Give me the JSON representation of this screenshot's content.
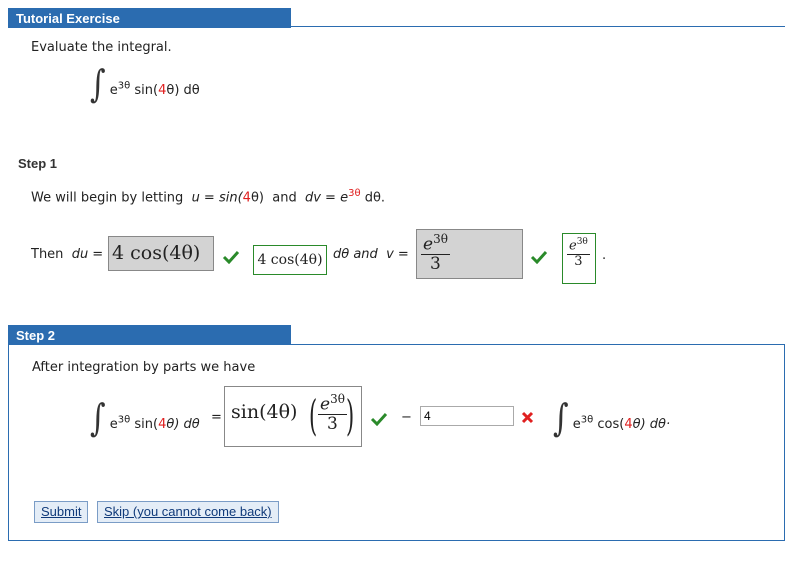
{
  "header": {
    "title": "Tutorial Exercise"
  },
  "intro": {
    "prompt": "Evaluate the integral.",
    "integral": {
      "exp": "3θ",
      "func": "sin(",
      "coef": "4",
      "arg_tail": "θ) dθ"
    }
  },
  "step1": {
    "title": "Step 1",
    "sentence": {
      "pre": "We will begin by letting",
      "u_eq": "u = sin(",
      "u_coef": "4",
      "u_tail": "θ)",
      "and": "and",
      "dv_eq": "dv = e",
      "dv_exp": "3θ",
      "dv_tail": " dθ."
    },
    "then_label": "Then",
    "du_label": "du =",
    "du_answer": "4 cos(4θ)",
    "du_correct": "4 cos(4θ)",
    "dtheta_and": "dθ and",
    "v_label": "v =",
    "v_answer": {
      "num": "e",
      "num_exp": "3θ",
      "den": "3"
    },
    "v_correct": {
      "num": "e",
      "num_exp": "3θ",
      "den": "3"
    },
    "period": "."
  },
  "step2": {
    "title": "Step 2",
    "intro": "After integration by parts we have",
    "lhs": {
      "exp": "3θ",
      "func": "sin(",
      "coef": "4",
      "tail": "θ) dθ"
    },
    "equals": "=",
    "answer1": {
      "lead": "sin(",
      "coef": "4θ",
      "close": ")",
      "num": "e",
      "num_exp": "3θ",
      "den": "3"
    },
    "minus": "−",
    "input_value": "4",
    "rhs_integral": {
      "exp": "3θ",
      "func": "cos(",
      "coef": "4",
      "tail": "θ) dθ·"
    }
  },
  "buttons": {
    "submit": "Submit",
    "skip": "Skip (you cannot come back)"
  },
  "colors": {
    "header": "#2b6cb0",
    "correct": "#2a8a2a",
    "incorrect": "#e02020",
    "highlight": "#e02020"
  }
}
